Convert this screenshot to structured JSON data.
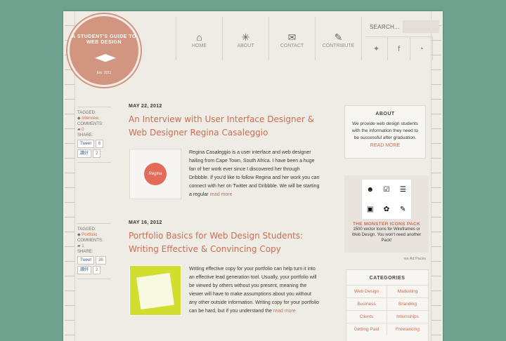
{
  "logo": {
    "line1": "A STUDENT'S GUIDE TO WEB DESIGN",
    "est": "Est. 2011"
  },
  "nav": [
    {
      "icon": "home-icon",
      "glyph": "⌂",
      "label": "HOME"
    },
    {
      "icon": "lightbulb-icon",
      "glyph": "✳",
      "label": "ABOUT"
    },
    {
      "icon": "mail-icon",
      "glyph": "✉",
      "label": "CONTACT"
    },
    {
      "icon": "pencil-icon",
      "glyph": "✎",
      "label": "CONTRIBUTE"
    }
  ],
  "search": {
    "label": "SEARCH..."
  },
  "social": [
    {
      "icon": "twitter-icon",
      "glyph": "✦"
    },
    {
      "icon": "facebook-icon",
      "glyph": "f"
    },
    {
      "icon": "rss-icon",
      "glyph": "◔"
    }
  ],
  "meta_labels": {
    "tagged": "TAGGED:",
    "comments": "COMMENTS:",
    "share": "SHARE:",
    "tweet": "Tweet",
    "fb": "讚好"
  },
  "posts": [
    {
      "tag": "Interview",
      "comments": "0",
      "tweets": "6",
      "likes": "2",
      "date": "MAY 22, 2012",
      "title": "An Interview with User Interface Designer & Web Designer Regina Casaleggio",
      "excerpt": "Regina Casaleggio is a user interface and web designer hailing from Cape Town, South Africa. I have been a huge fan of her work ever since I discovered her through Dribbble. If you'd like to follow Regina and her work you can connect with her on Twitter and Dribbble. We will be starting a regular",
      "more": "read more",
      "thumb_text": "Regina"
    },
    {
      "tag": "Portfolio",
      "comments": "1",
      "tweets": "38",
      "likes": "2",
      "date": "MAY 16, 2012",
      "title": "Portfolio Basics for Web Design Students: Writing Effective & Convincing Copy",
      "excerpt": "Writing effective copy for your portfolio can help turn it into an effective lead generation tool. Usually, your portfolio will be viewed by others without you present, meaning the viewer will have to make assumptions about you without any other outside information. Writing copy for your portfolio can be hard, but if you understand the",
      "more": "read more"
    }
  ],
  "about": {
    "title": "ABOUT",
    "text": "We provide web design students with the information they need to be successful after graduation.",
    "link": "READ MORE"
  },
  "ad": {
    "icons": [
      "person-icon",
      "clipboard-icon",
      "sliders-icon",
      "printer-icon",
      "plant-icon",
      "edit-icon"
    ],
    "glyphs": [
      "☻",
      "☑",
      "☰",
      "▣",
      "✿",
      "✎"
    ],
    "title": "THE MONSTER ICONS PACK",
    "text": "1500 vector Icons for Wireframes or Web Design. You won't need another Pack!",
    "via": "via Ad Packs"
  },
  "categories": {
    "title": "CATEGORIES",
    "items": [
      "Web Design",
      "Marketing",
      "Business",
      "Branding",
      "Clients",
      "Internships",
      "Getting Paid",
      "Freelancing"
    ]
  }
}
